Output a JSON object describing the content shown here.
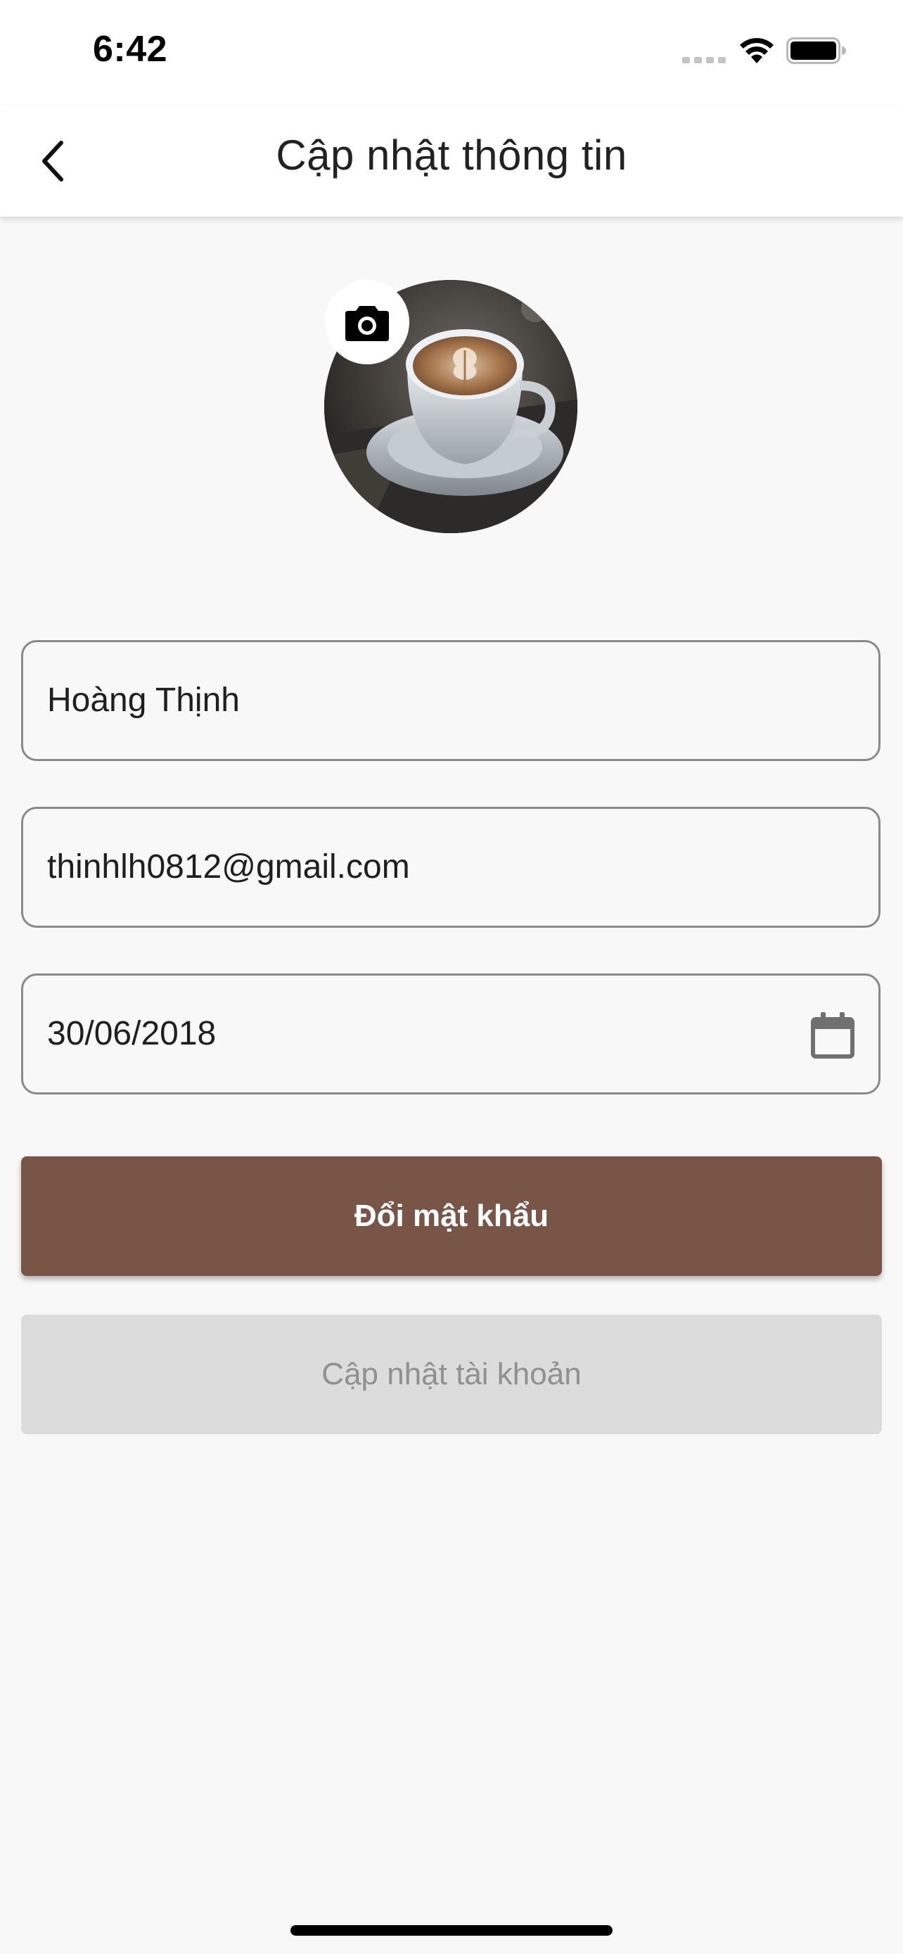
{
  "status_bar": {
    "time": "6:42"
  },
  "app_bar": {
    "title": "Cập nhật thông tin"
  },
  "form": {
    "name_value": "Hoàng Thịnh",
    "email_value": "thinhlh0812@gmail.com",
    "birthdate_value": "30/06/2018"
  },
  "buttons": {
    "change_password": "Đổi mật khẩu",
    "update_account": "Cập nhật tài khoản"
  },
  "colors": {
    "primary_brown": "#795548",
    "disabled_button_bg": "#dcdcdc",
    "disabled_button_text": "#909090",
    "page_background": "#f8f8f8"
  },
  "icons": {
    "back": "chevron-left-icon",
    "camera": "camera-icon",
    "calendar": "calendar-icon",
    "wifi": "wifi-icon",
    "battery": "battery-icon",
    "signal": "signal-icon"
  }
}
